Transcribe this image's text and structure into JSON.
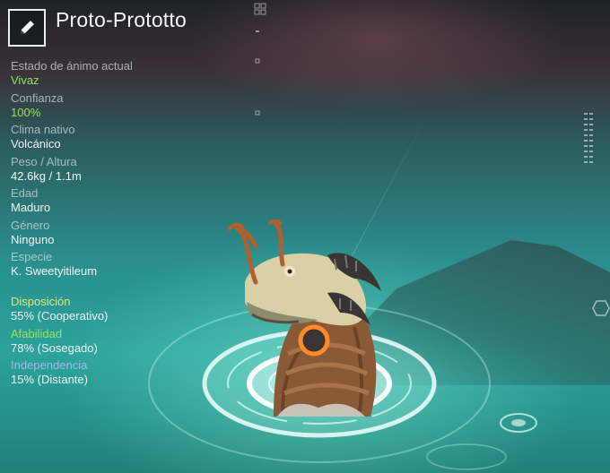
{
  "creature": {
    "name": "Proto-Prototto"
  },
  "icons": {
    "edit": "pencil-icon"
  },
  "stats": [
    {
      "label": "Estado de ánimo actual",
      "value": "Vivaz",
      "highlight": true
    },
    {
      "label": "Confianza",
      "value": "100%",
      "highlight": true
    },
    {
      "label": "Clima nativo",
      "value": "Volcánico",
      "highlight": false
    },
    {
      "label": "Peso / Altura",
      "value": "42.6kg / 1.1m",
      "highlight": false
    },
    {
      "label": "Edad",
      "value": "Maduro",
      "highlight": false
    },
    {
      "label": "Género",
      "value": "Ninguno",
      "highlight": false
    },
    {
      "label": "Especie",
      "value": "K. Sweetyitileum",
      "highlight": false
    }
  ],
  "personality": [
    {
      "label": "Disposición",
      "value": "55% (Cooperativo)",
      "color": "#dfe97a"
    },
    {
      "label": "Afabilidad",
      "value": "78% (Sosegado)",
      "color": "#9ee35c"
    },
    {
      "label": "Independencia",
      "value": "15% (Distante)",
      "color": "#a9b7e6"
    }
  ],
  "colors": {
    "accent_green": "#8fe84a",
    "text": "#f2f5f5",
    "label": "#d2dcde"
  }
}
